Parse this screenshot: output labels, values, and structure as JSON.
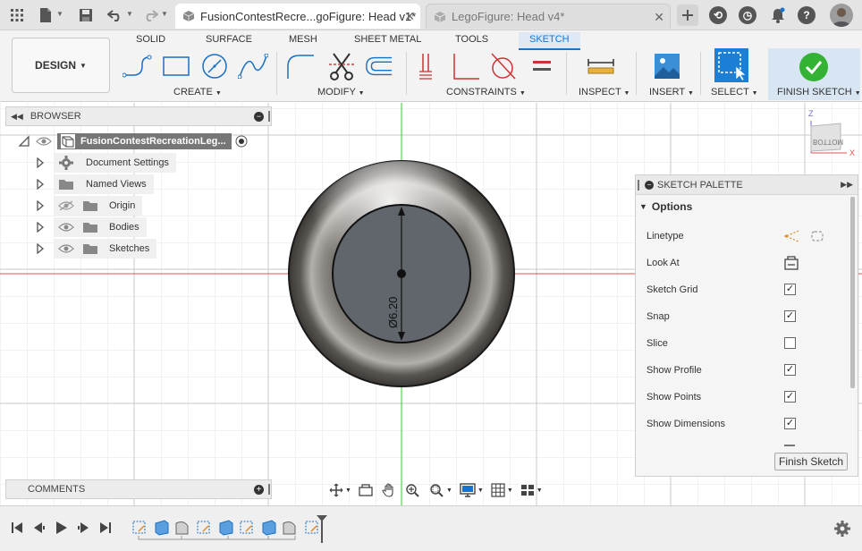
{
  "tabs": [
    {
      "label": "FusionContestRecre...goFigure: Head v1*",
      "active": true
    },
    {
      "label": "LegoFigure: Head v4*",
      "active": false
    }
  ],
  "ribbon": {
    "design_label": "DESIGN",
    "tabs": [
      "SOLID",
      "SURFACE",
      "MESH",
      "SHEET METAL",
      "TOOLS",
      "SKETCH"
    ],
    "active_tab": "SKETCH",
    "groups": {
      "create": "CREATE",
      "modify": "MODIFY",
      "constraints": "CONSTRAINTS",
      "inspect": "INSPECT",
      "insert": "INSERT",
      "select": "SELECT",
      "finish": "FINISH SKETCH"
    }
  },
  "browser": {
    "title": "BROWSER",
    "root": "FusionContestRecreationLeg...",
    "items": [
      {
        "label": "Document Settings",
        "icon": "gear-icon"
      },
      {
        "label": "Named Views",
        "icon": "folder-icon"
      },
      {
        "label": "Origin",
        "icon": "folder-icon",
        "hidden": true
      },
      {
        "label": "Bodies",
        "icon": "folder-icon"
      },
      {
        "label": "Sketches",
        "icon": "folder-icon"
      }
    ]
  },
  "comments": {
    "title": "COMMENTS"
  },
  "viewcube": {
    "face": "BOTTOM",
    "axis_z": "Z",
    "axis_x": "X"
  },
  "sketch": {
    "dimension": "Ø6.20"
  },
  "palette": {
    "title": "SKETCH PALETTE",
    "section": "Options",
    "options": [
      {
        "label": "Linetype",
        "control": "icons"
      },
      {
        "label": "Look At",
        "control": "look-at-icon"
      },
      {
        "label": "Sketch Grid",
        "checked": true
      },
      {
        "label": "Snap",
        "checked": true
      },
      {
        "label": "Slice",
        "checked": false
      },
      {
        "label": "Show Profile",
        "checked": true
      },
      {
        "label": "Show Points",
        "checked": true
      },
      {
        "label": "Show Dimensions",
        "checked": true
      }
    ],
    "finish_button": "Finish Sketch"
  },
  "colors": {
    "accent": "#1a73c8",
    "finish_green": "#34b233",
    "axis_red": "#e05050",
    "axis_green": "#3cc43c"
  }
}
